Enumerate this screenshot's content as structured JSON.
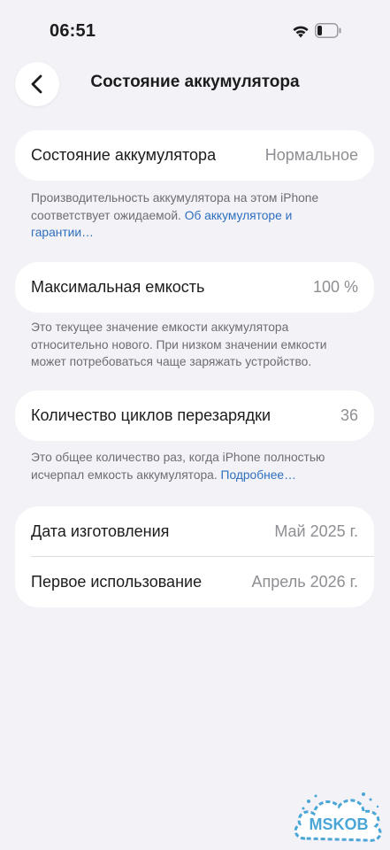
{
  "status": {
    "time": "06:51"
  },
  "nav": {
    "back_icon": "chevron-left-icon",
    "title": "Состояние аккумулятора"
  },
  "health": {
    "label": "Состояние аккумулятора",
    "value": "Нормальное",
    "note_text": "Производительность аккумулятора на этом iPhone соответствует ожидаемой.",
    "note_link": "Об аккумуляторе и гарантии…"
  },
  "capacity": {
    "label": "Максимальная емкость",
    "value": "100 %",
    "note": "Это текущее значение емкости аккумулятора относительно нового. При низком значении емкости может потребоваться чаще заряжать устройство."
  },
  "cycles": {
    "label": "Количество циклов перезарядки",
    "value": "36",
    "note_text": "Это общее количество раз, когда iPhone полностью исчерпал емкость аккумулятора.",
    "note_link": "Подробнее…"
  },
  "dates": {
    "manufacture_label": "Дата изготовления",
    "manufacture_value": "Май 2025 г.",
    "first_use_label": "Первое использование",
    "first_use_value": "Апрель 2026 г."
  },
  "watermark": {
    "text": "MSKOB"
  },
  "colors": {
    "background": "#f2f2f7",
    "card": "#ffffff",
    "link": "#2f6fbf",
    "secondary": "#8e8e93",
    "watermark": "#4aa6d6"
  }
}
